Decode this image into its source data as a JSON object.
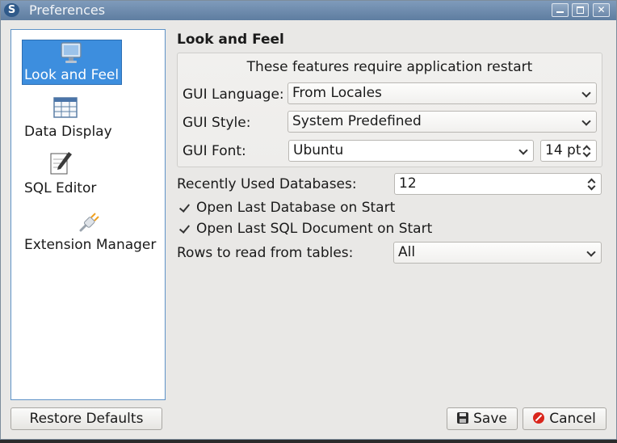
{
  "window": {
    "title": "Preferences",
    "app_icon_letter": "S"
  },
  "sidebar": {
    "items": [
      {
        "label": "Look and Feel",
        "icon": "monitor-icon",
        "selected": true
      },
      {
        "label": "Data Display",
        "icon": "table-icon",
        "selected": false
      },
      {
        "label": "SQL Editor",
        "icon": "pencil-paper-icon",
        "selected": false
      },
      {
        "label": "Extension Manager",
        "icon": "plug-icon",
        "selected": false
      }
    ]
  },
  "main": {
    "title": "Look and Feel",
    "restart_note": "These features require application restart",
    "gui_language": {
      "label": "GUI Language:",
      "value": "From Locales"
    },
    "gui_style": {
      "label": "GUI Style:",
      "value": "System Predefined"
    },
    "gui_font": {
      "label": "GUI Font:",
      "value": "Ubuntu",
      "size": "14 pt"
    },
    "recent_dbs": {
      "label": "Recently Used Databases:",
      "value": "12"
    },
    "open_last_db": {
      "label": "Open Last Database on Start",
      "checked": true
    },
    "open_last_sql": {
      "label": "Open Last SQL Document on Start",
      "checked": true
    },
    "rows_to_read": {
      "label": "Rows to read from tables:",
      "value": "All"
    }
  },
  "buttons": {
    "restore_defaults": "Restore Defaults",
    "save": "Save",
    "cancel": "Cancel"
  },
  "colors": {
    "selection": "#3d8ede",
    "titlebar": "#6f8db0"
  }
}
